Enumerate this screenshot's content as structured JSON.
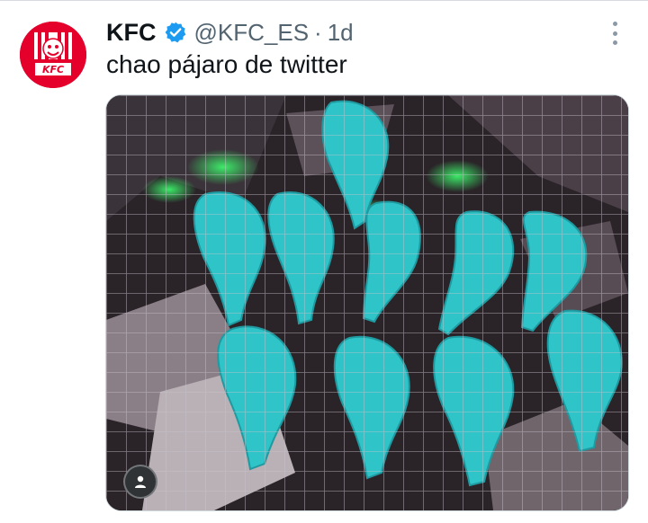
{
  "tweet": {
    "display_name": "KFC",
    "handle": "@KFC_ES",
    "separator": "·",
    "time": "1d",
    "text": "chao pájaro de twitter",
    "avatar_label": "KFC"
  },
  "colors": {
    "brand_red": "#e4002b",
    "verified_blue": "#1d9bf0",
    "chicken_cyan": "#2fc4c8"
  },
  "icons": {
    "verified": "verified-badge-icon",
    "more": "more-options-icon",
    "user": "user-icon"
  }
}
